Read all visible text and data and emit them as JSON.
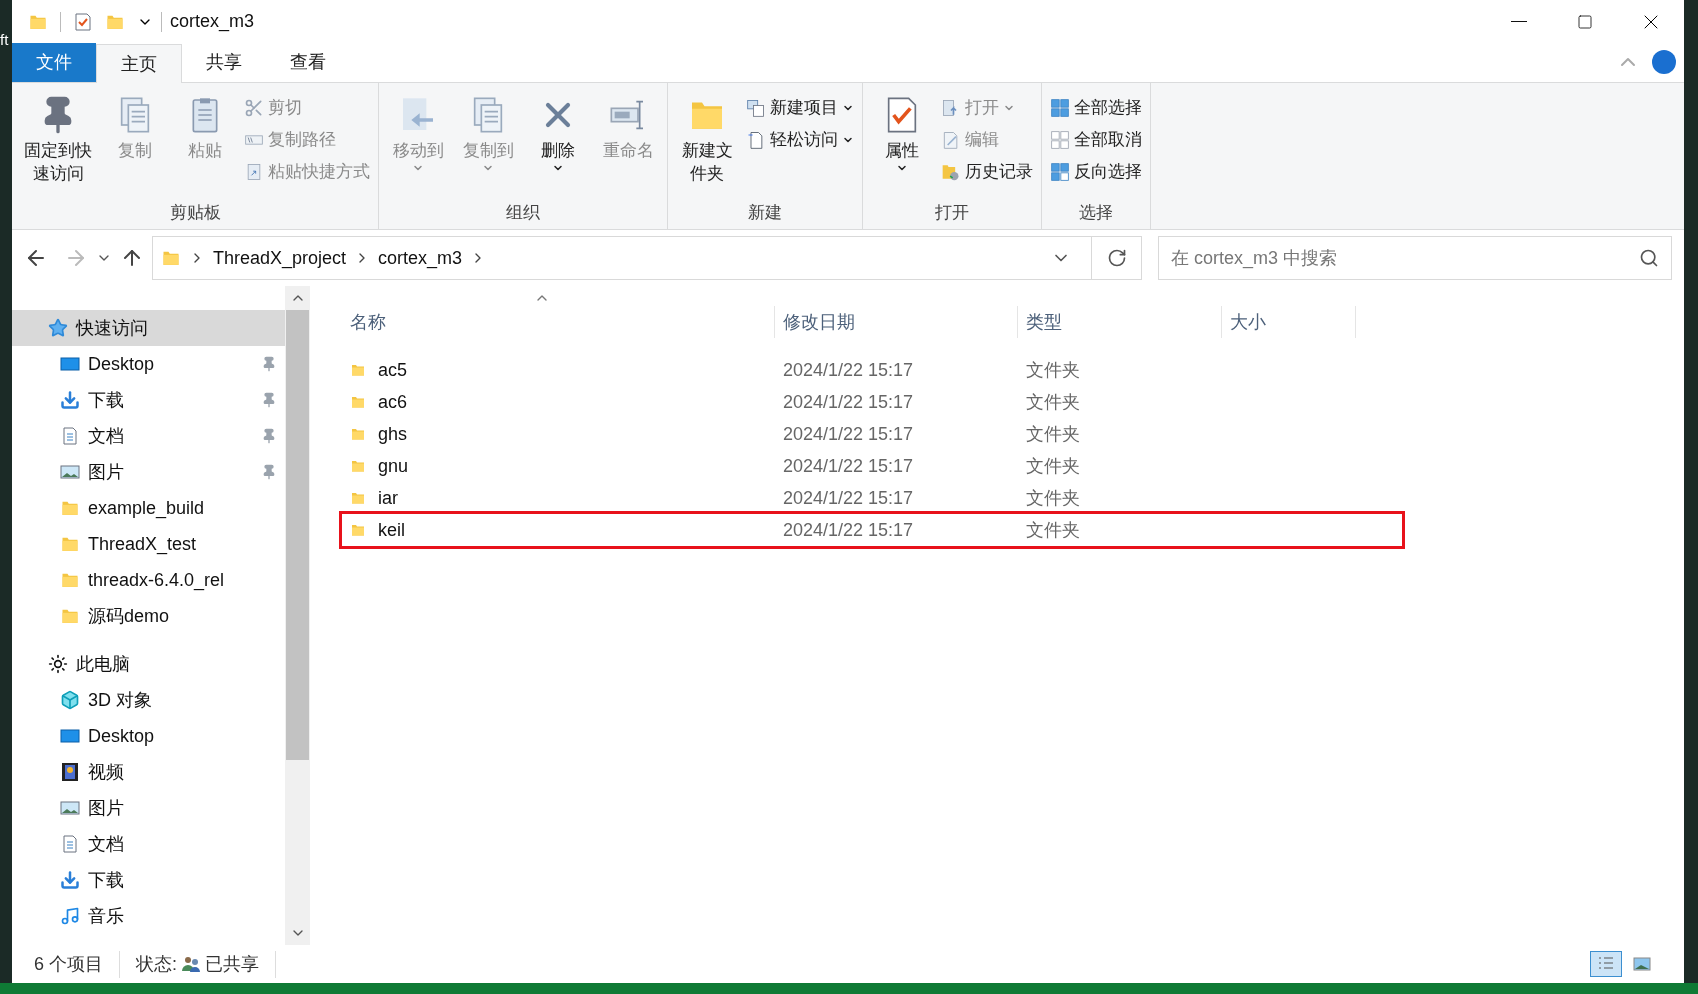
{
  "desktop_fragment": "ft",
  "window": {
    "title": "cortex_m3"
  },
  "ribbon_tabs": [
    {
      "label": "文件",
      "kind": "file",
      "selected": false
    },
    {
      "label": "主页",
      "kind": "tab",
      "selected": true
    },
    {
      "label": "共享",
      "kind": "tab",
      "selected": false
    },
    {
      "label": "查看",
      "kind": "tab",
      "selected": false
    }
  ],
  "ribbon_groups": [
    {
      "label": "剪贴板",
      "large": [
        {
          "label": "固定到快速访问",
          "kind": "pin",
          "disabled": false
        },
        {
          "label": "复制",
          "kind": "copy",
          "disabled": true
        },
        {
          "label": "粘贴",
          "kind": "paste",
          "disabled": true
        }
      ],
      "small": [
        {
          "label": "剪切",
          "kind": "cut",
          "disabled": true
        },
        {
          "label": "复制路径",
          "kind": "path",
          "disabled": true
        },
        {
          "label": "粘贴快捷方式",
          "kind": "shortcut",
          "disabled": true
        }
      ]
    },
    {
      "label": "组织",
      "large": [
        {
          "label": "移动到",
          "kind": "move",
          "disabled": true,
          "dropdown": true
        },
        {
          "label": "复制到",
          "kind": "copyto",
          "disabled": true,
          "dropdown": true
        },
        {
          "label": "删除",
          "kind": "delete",
          "disabled": false,
          "dropdown": true
        },
        {
          "label": "重命名",
          "kind": "rename",
          "disabled": true
        }
      ]
    },
    {
      "label": "新建",
      "large": [
        {
          "label": "新建文件夹",
          "kind": "folder",
          "disabled": false
        }
      ],
      "small": [
        {
          "label": "新建项目",
          "kind": "newitem",
          "disabled": false,
          "dropdown": true
        },
        {
          "label": "轻松访问",
          "kind": "easy",
          "disabled": false,
          "dropdown": true
        }
      ]
    },
    {
      "label": "打开",
      "large": [
        {
          "label": "属性",
          "kind": "props",
          "disabled": false,
          "dropdown": true
        }
      ],
      "small": [
        {
          "label": "打开",
          "kind": "open",
          "disabled": true,
          "dropdown": true
        },
        {
          "label": "编辑",
          "kind": "edit",
          "disabled": true
        },
        {
          "label": "历史记录",
          "kind": "history",
          "disabled": false
        }
      ]
    },
    {
      "label": "选择",
      "small": [
        {
          "label": "全部选择",
          "kind": "selall",
          "disabled": false
        },
        {
          "label": "全部取消",
          "kind": "selnone",
          "disabled": false
        },
        {
          "label": "反向选择",
          "kind": "selinv",
          "disabled": false
        }
      ]
    }
  ],
  "address": {
    "crumbs": [
      "ThreadX_project",
      "cortex_m3"
    ]
  },
  "search": {
    "placeholder": "在 cortex_m3 中搜索"
  },
  "nav": [
    {
      "label": "快速访问",
      "kind": "star",
      "selected": true,
      "children": [
        {
          "label": "Desktop",
          "kind": "desktop",
          "pinned": true
        },
        {
          "label": "下载",
          "kind": "download",
          "pinned": true
        },
        {
          "label": "文档",
          "kind": "doc",
          "pinned": true
        },
        {
          "label": "图片",
          "kind": "image",
          "pinned": true
        },
        {
          "label": "example_build",
          "kind": "folder",
          "pinned": false
        },
        {
          "label": "ThreadX_test",
          "kind": "folder",
          "pinned": false
        },
        {
          "label": "threadx-6.4.0_rel",
          "kind": "folder",
          "pinned": false
        },
        {
          "label": "源码demo",
          "kind": "folder",
          "pinned": false
        }
      ]
    },
    {
      "label": "此电脑",
      "kind": "pc",
      "selected": false,
      "children": [
        {
          "label": "3D 对象",
          "kind": "cube",
          "pinned": false
        },
        {
          "label": "Desktop",
          "kind": "desktop",
          "pinned": false
        },
        {
          "label": "视频",
          "kind": "video",
          "pinned": false
        },
        {
          "label": "图片",
          "kind": "image",
          "pinned": false
        },
        {
          "label": "文档",
          "kind": "doc",
          "pinned": false
        },
        {
          "label": "下载",
          "kind": "download",
          "pinned": false
        },
        {
          "label": "音乐",
          "kind": "music",
          "pinned": false
        }
      ]
    }
  ],
  "table": {
    "columns": [
      "名称",
      "修改日期",
      "类型",
      "大小"
    ],
    "rows": [
      {
        "name": "ac5",
        "date": "2024/1/22 15:17",
        "type": "文件夹",
        "highlighted": false
      },
      {
        "name": "ac6",
        "date": "2024/1/22 15:17",
        "type": "文件夹",
        "highlighted": false
      },
      {
        "name": "ghs",
        "date": "2024/1/22 15:17",
        "type": "文件夹",
        "highlighted": false
      },
      {
        "name": "gnu",
        "date": "2024/1/22 15:17",
        "type": "文件夹",
        "highlighted": false
      },
      {
        "name": "iar",
        "date": "2024/1/22 15:17",
        "type": "文件夹",
        "highlighted": false
      },
      {
        "name": "keil",
        "date": "2024/1/22 15:17",
        "type": "文件夹",
        "highlighted": true
      }
    ]
  },
  "status_bar": {
    "count": "6 个项目",
    "state_label": "状态:",
    "state": "已共享"
  },
  "view_buttons": [
    {
      "kind": "details",
      "selected": true
    },
    {
      "kind": "thumbs",
      "selected": false
    }
  ]
}
